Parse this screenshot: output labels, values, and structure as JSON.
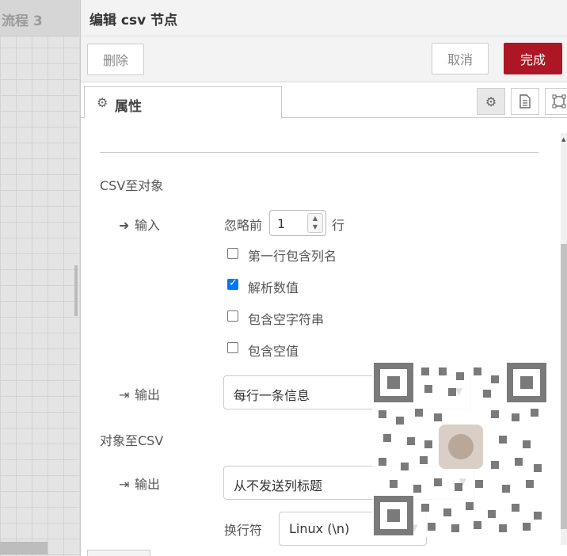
{
  "workspace": {
    "flow_tab_label": "流程 3"
  },
  "tray": {
    "title": "编辑 csv 节点",
    "buttons": {
      "delete": "删除",
      "cancel": "取消",
      "done": "完成"
    },
    "tabs": [
      {
        "label": "属性",
        "icon": "gear-icon"
      }
    ],
    "tab_icons": [
      "gear-icon",
      "document-icon",
      "frame-icon"
    ]
  },
  "form": {
    "csv_to_object": {
      "section_title": "CSV至对象",
      "input_label": "输入",
      "skip_prefix": "忽略前",
      "skip_value": "1",
      "skip_suffix": "行",
      "checkboxes": [
        {
          "label": "第一行包含列名",
          "checked": false
        },
        {
          "label": "解析数值",
          "checked": true
        },
        {
          "label": "包含空字符串",
          "checked": false
        },
        {
          "label": "包含空值",
          "checked": false
        }
      ],
      "output_label": "输出",
      "output_value": "每行一条信息"
    },
    "object_to_csv": {
      "section_title": "对象至CSV",
      "output_label": "输出",
      "output_value": "从不发送列标题",
      "newline_label": "换行符",
      "newline_value": "Linux (\\n)"
    }
  },
  "colors": {
    "accent": "#ad1625",
    "checkbox": "#0075ff"
  }
}
